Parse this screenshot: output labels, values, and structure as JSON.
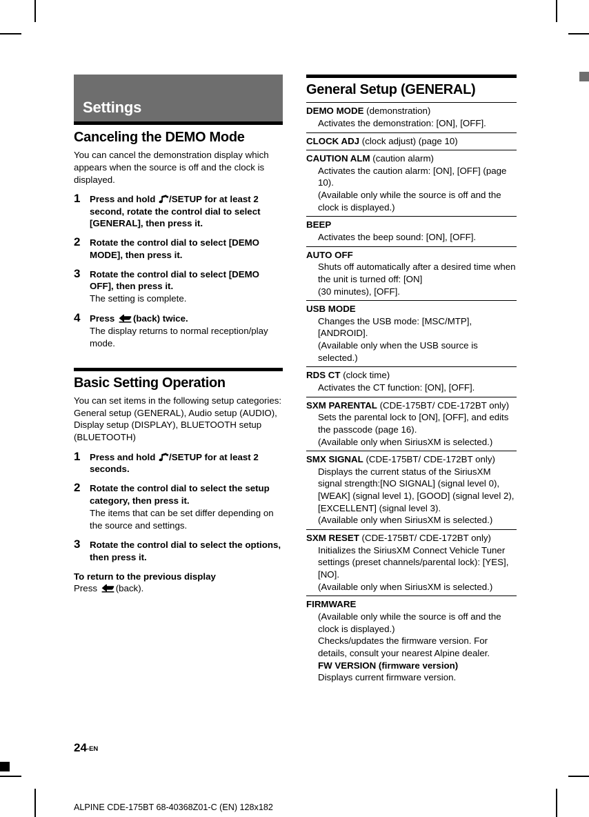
{
  "document": {
    "folio_number": "24",
    "folio_language": "-EN",
    "print_caption": "ALPINE CDE-175BT 68-40368Z01-C (EN) 128x182",
    "banner_color": "#6e6e6e",
    "rule_color": "#000000"
  },
  "left_column": {
    "chapter_title": "Settings",
    "section_demo": {
      "heading": "Canceling the DEMO Mode",
      "intro": "You can cancel the demonstration display which appears when the source is off and the clock is displayed.",
      "steps": [
        {
          "number": "1",
          "title_before_icon": "Press and hold ",
          "icon": "setup-note-icon",
          "title_after_icon": "/SETUP for at least 2 second, rotate the control dial to select [GENERAL], then press it.",
          "note": ""
        },
        {
          "number": "2",
          "title_before_icon": "Rotate the control dial to select [DEMO MODE], then press it.",
          "icon": "",
          "title_after_icon": "",
          "note": ""
        },
        {
          "number": "3",
          "title_before_icon": "Rotate the control dial to select [DEMO OFF], then press it.",
          "icon": "",
          "title_after_icon": "",
          "note": "The setting is complete."
        },
        {
          "number": "4",
          "title_before_icon": "Press ",
          "icon": "back-arrow-icon",
          "title_after_icon": "(back) twice.",
          "note": "The display returns to normal reception/play mode."
        }
      ]
    },
    "section_basic": {
      "heading": "Basic Setting Operation",
      "intro_line1": "You can set items in the following setup categories:",
      "intro_line2": "General setup (GENERAL), Audio setup (AUDIO), Display setup (DISPLAY), BLUETOOTH setup (BLUETOOTH)",
      "steps": [
        {
          "number": "1",
          "title_before_icon": "Press and hold ",
          "icon": "setup-note-icon",
          "title_after_icon": "/SETUP for at least 2 seconds.",
          "note": ""
        },
        {
          "number": "2",
          "title_before_icon": "Rotate the control dial to select the setup category, then press it.",
          "icon": "",
          "title_after_icon": "",
          "note": "The items that can be set differ depending on the source and settings."
        },
        {
          "number": "3",
          "title_before_icon": "Rotate the control dial to select the options, then press it.",
          "icon": "",
          "title_after_icon": "",
          "note": ""
        }
      ],
      "return_heading": "To return to the previous display",
      "return_before_icon": "Press ",
      "return_icon": "back-arrow-icon",
      "return_after_icon": "(back)."
    }
  },
  "right_column": {
    "heading": "General Setup (GENERAL)",
    "settings": [
      {
        "term_bold": "DEMO MODE",
        "term_rest": " (demonstration)",
        "lines": [
          "Activates the demonstration: [ON], [OFF]."
        ]
      },
      {
        "term_bold": "CLOCK ADJ",
        "term_rest": " (clock adjust) (page 10)",
        "lines": []
      },
      {
        "term_bold": "CAUTION ALM",
        "term_rest": " (caution alarm)",
        "lines": [
          "Activates the caution alarm: [ON], [OFF] (page 10).",
          "(Available only while the source is off and the clock is displayed.)"
        ]
      },
      {
        "term_bold": "BEEP",
        "term_rest": "",
        "lines": [
          "Activates the beep sound: [ON], [OFF]."
        ]
      },
      {
        "term_bold": "AUTO OFF",
        "term_rest": "",
        "lines": [
          "Shuts off automatically after a desired time when the unit is turned off: [ON]",
          "(30 minutes), [OFF]."
        ]
      },
      {
        "term_bold": "USB MODE",
        "term_rest": "",
        "lines": [
          "Changes the USB mode: [MSC/MTP], [ANDROID].",
          "(Available only when the USB source is selected.)"
        ]
      },
      {
        "term_bold": "RDS CT",
        "term_rest": " (clock time)",
        "lines": [
          "Activates the CT function: [ON], [OFF]."
        ]
      },
      {
        "term_bold": "SXM PARENTAL",
        "term_rest": " (CDE-175BT/ CDE-172BT only)",
        "lines": [
          "Sets the parental lock to [ON], [OFF], and edits the passcode (page 16).",
          "(Available only when SiriusXM is selected.)"
        ]
      },
      {
        "term_bold": "SMX SIGNAL",
        "term_rest": " (CDE-175BT/ CDE-172BT only)",
        "lines": [
          "Displays the current status of the SiriusXM signal strength:[NO SIGNAL] (signal level 0), [WEAK] (signal level 1), [GOOD] (signal level 2), [EXCELLENT] (signal level 3).",
          "(Available only when SiriusXM is selected.)"
        ]
      },
      {
        "term_bold": "SXM RESET",
        "term_rest": " (CDE-175BT/ CDE-172BT only)",
        "lines": [
          "Initializes the SiriusXM Connect Vehicle Tuner settings (preset channels/parental lock): [YES], [NO].",
          "(Available only when SiriusXM is selected.)"
        ]
      },
      {
        "term_bold": "FIRMWARE",
        "term_rest": "",
        "lines": [
          "(Available only while the source is off and the clock is displayed.)",
          "Checks/updates the firmware version. For details, consult your nearest Alpine dealer."
        ],
        "sub_bold": "FW VERSION (firmware version)",
        "sub_line": "Displays current firmware version."
      }
    ]
  }
}
